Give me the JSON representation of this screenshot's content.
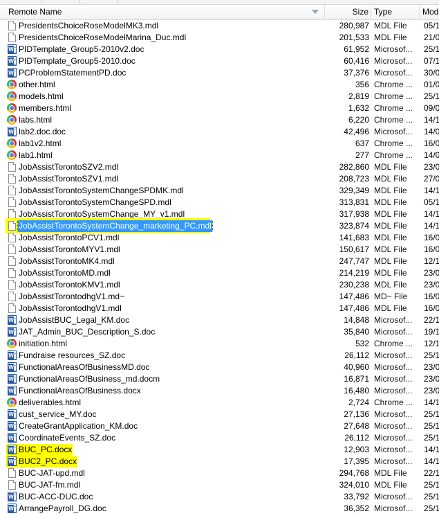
{
  "header": {
    "name": "Remote Name",
    "size": "Size",
    "type": "Type",
    "modified": "Mod"
  },
  "rows": [
    {
      "name": "PresidentsChoiceRoseModelMK3.mdl",
      "size": "280,987",
      "type": "MDL File",
      "mod": "05/1",
      "icon": "file-icon",
      "hl": ""
    },
    {
      "name": "PresidentsChoiceRoseModelMarina_Duc.mdl",
      "size": "201,533",
      "type": "MDL File",
      "mod": "21/0",
      "icon": "file-icon",
      "hl": ""
    },
    {
      "name": "PIDTemplate_Group5-2010v2.doc",
      "size": "61,952",
      "type": "Microsof...",
      "mod": "25/1",
      "icon": "word-doc-icon",
      "hl": ""
    },
    {
      "name": "PIDTemplate_Group5-2010.doc",
      "size": "60,416",
      "type": "Microsof...",
      "mod": "07/1",
      "icon": "word-doc-icon",
      "hl": ""
    },
    {
      "name": "PCProblemStatementPD.doc",
      "size": "37,376",
      "type": "Microsof...",
      "mod": "30/0",
      "icon": "word-doc-icon",
      "hl": ""
    },
    {
      "name": "other.html",
      "size": "356",
      "type": "Chrome ...",
      "mod": "01/0",
      "icon": "chrome-icon",
      "hl": ""
    },
    {
      "name": "models.html",
      "size": "2,819",
      "type": "Chrome ...",
      "mod": "25/1",
      "icon": "chrome-icon",
      "hl": ""
    },
    {
      "name": "members.html",
      "size": "1,632",
      "type": "Chrome ...",
      "mod": "09/0",
      "icon": "chrome-icon",
      "hl": ""
    },
    {
      "name": "labs.html",
      "size": "6,220",
      "type": "Chrome ...",
      "mod": "14/1",
      "icon": "chrome-icon",
      "hl": ""
    },
    {
      "name": "lab2.doc.doc",
      "size": "42,496",
      "type": "Microsof...",
      "mod": "14/0",
      "icon": "word-doc-icon",
      "hl": ""
    },
    {
      "name": "lab1v2.html",
      "size": "637",
      "type": "Chrome ...",
      "mod": "16/0",
      "icon": "chrome-icon",
      "hl": ""
    },
    {
      "name": "lab1.html",
      "size": "277",
      "type": "Chrome ...",
      "mod": "14/0",
      "icon": "chrome-icon",
      "hl": ""
    },
    {
      "name": "JobAssistTorontoSZV2.mdl",
      "size": "282,860",
      "type": "MDL File",
      "mod": "23/0",
      "icon": "file-icon",
      "hl": ""
    },
    {
      "name": "JobAssistTorontoSZV1.mdl",
      "size": "208,723",
      "type": "MDL File",
      "mod": "27/0",
      "icon": "file-icon",
      "hl": ""
    },
    {
      "name": "JobAssistTorontoSystemChangeSPDMK.mdl",
      "size": "329,349",
      "type": "MDL File",
      "mod": "14/1",
      "icon": "file-icon",
      "hl": ""
    },
    {
      "name": "JobAssistTorontoSystemChangeSPD.mdl",
      "size": "313,831",
      "type": "MDL File",
      "mod": "05/1",
      "icon": "file-icon",
      "hl": ""
    },
    {
      "name": "JobAssistTorontoSystemChange_MY_v1.mdl",
      "size": "317,938",
      "type": "MDL File",
      "mod": "14/1",
      "icon": "file-icon",
      "hl": ""
    },
    {
      "name": "JobAssistTorontoSystemChange_marketing_PC.mdl",
      "size": "323,874",
      "type": "MDL File",
      "mod": "14/1",
      "icon": "file-icon",
      "hl": "select"
    },
    {
      "name": "JobAssistTorontoPCV1.mdl",
      "size": "141,683",
      "type": "MDL File",
      "mod": "16/0",
      "icon": "file-icon",
      "hl": ""
    },
    {
      "name": "JobAssistTorontoMYV1.mdl",
      "size": "150,617",
      "type": "MDL File",
      "mod": "16/0",
      "icon": "file-icon",
      "hl": ""
    },
    {
      "name": "JobAssistTorontoMK4.mdl",
      "size": "247,747",
      "type": "MDL File",
      "mod": "12/1",
      "icon": "file-icon",
      "hl": ""
    },
    {
      "name": "JobAssistTorontoMD.mdl",
      "size": "214,219",
      "type": "MDL File",
      "mod": "23/0",
      "icon": "file-icon",
      "hl": ""
    },
    {
      "name": "JobAssistTorontoKMV1.mdl",
      "size": "230,238",
      "type": "MDL File",
      "mod": "23/0",
      "icon": "file-icon",
      "hl": ""
    },
    {
      "name": "JobAssistTorontodhgV1.md~",
      "size": "147,486",
      "type": "MD~ File",
      "mod": "16/0",
      "icon": "file-icon",
      "hl": ""
    },
    {
      "name": "JobAssistTorontodhgV1.mdl",
      "size": "147,486",
      "type": "MDL File",
      "mod": "16/0",
      "icon": "file-icon",
      "hl": ""
    },
    {
      "name": "JobAssistBUC_Legal_KM.doc",
      "size": "14,848",
      "type": "Microsof...",
      "mod": "22/1",
      "icon": "word-doc-icon",
      "hl": ""
    },
    {
      "name": "JAT_Admin_BUC_Description_S.doc",
      "size": "35,840",
      "type": "Microsof...",
      "mod": "19/1",
      "icon": "word-doc-icon",
      "hl": ""
    },
    {
      "name": "initiation.html",
      "size": "532",
      "type": "Chrome ...",
      "mod": "12/1",
      "icon": "chrome-icon",
      "hl": ""
    },
    {
      "name": "Fundraise resources_SZ.doc",
      "size": "26,112",
      "type": "Microsof...",
      "mod": "25/1",
      "icon": "word-doc-icon",
      "hl": ""
    },
    {
      "name": "FunctionalAreasOfBusinessMD.doc",
      "size": "40,960",
      "type": "Microsof...",
      "mod": "23/0",
      "icon": "word-doc-icon",
      "hl": ""
    },
    {
      "name": "FunctionalAreasOfBusiness_md.docm",
      "size": "16,871",
      "type": "Microsof...",
      "mod": "23/0",
      "icon": "word-doc-icon",
      "hl": ""
    },
    {
      "name": "FunctionalAreasOfBusiness.docx",
      "size": "16,480",
      "type": "Microsof...",
      "mod": "23/0",
      "icon": "word-doc-icon",
      "hl": ""
    },
    {
      "name": "deliverables.html",
      "size": "2,724",
      "type": "Chrome ...",
      "mod": "14/1",
      "icon": "chrome-icon",
      "hl": ""
    },
    {
      "name": "cust_service_MY.doc",
      "size": "27,136",
      "type": "Microsof...",
      "mod": "25/1",
      "icon": "word-doc-icon",
      "hl": ""
    },
    {
      "name": "CreateGrantApplication_KM.doc",
      "size": "27,648",
      "type": "Microsof...",
      "mod": "25/1",
      "icon": "word-doc-icon",
      "hl": ""
    },
    {
      "name": "CoordinateEvents_SZ.doc",
      "size": "26,112",
      "type": "Microsof...",
      "mod": "25/1",
      "icon": "word-doc-icon",
      "hl": ""
    },
    {
      "name": "BUC_PC.docx",
      "size": "12,903",
      "type": "Microsof...",
      "mod": "14/1",
      "icon": "word-doc-icon",
      "hl": "yellow"
    },
    {
      "name": "BUC2_PC.docx",
      "size": "17,395",
      "type": "Microsof...",
      "mod": "14/1",
      "icon": "word-doc-icon",
      "hl": "yellow"
    },
    {
      "name": "BUC-JAT-upd.mdl",
      "size": "294,768",
      "type": "MDL File",
      "mod": "22/1",
      "icon": "file-icon",
      "hl": ""
    },
    {
      "name": "BUC-JAT-fm.mdl",
      "size": "324,010",
      "type": "MDL File",
      "mod": "25/1",
      "icon": "file-icon",
      "hl": ""
    },
    {
      "name": "BUC-ACC-DUC.doc",
      "size": "33,792",
      "type": "Microsof...",
      "mod": "25/1",
      "icon": "word-doc-icon",
      "hl": ""
    },
    {
      "name": "ArrangePayroll_DG.doc",
      "size": "36,352",
      "type": "Microsof...",
      "mod": "25/1",
      "icon": "word-doc-icon",
      "hl": ""
    }
  ]
}
